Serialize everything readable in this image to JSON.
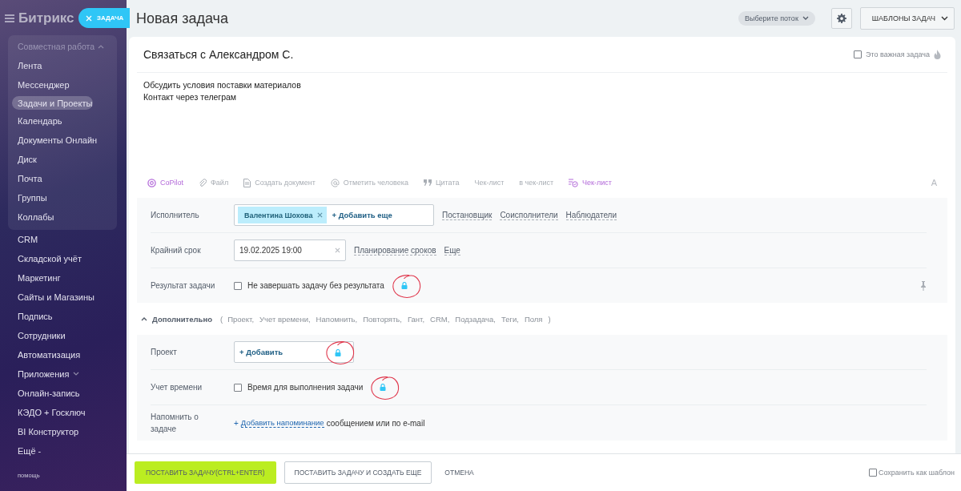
{
  "sidebar": {
    "logo": "Битрикс",
    "pill": "ЗАДАЧА",
    "group": {
      "label": "Совместная работа",
      "expanded": true,
      "children": [
        {
          "label": "Лента",
          "selected": false
        },
        {
          "label": "Мессенджер",
          "selected": false
        },
        {
          "label": "Задачи и Проекты",
          "selected": true
        },
        {
          "label": "Календарь",
          "selected": false
        },
        {
          "label": "Документы Онлайн",
          "selected": false
        },
        {
          "label": "Диск",
          "selected": false
        },
        {
          "label": "Почта",
          "selected": false
        },
        {
          "label": "Группы",
          "selected": false
        },
        {
          "label": "Коллабы",
          "selected": false
        }
      ]
    },
    "items": [
      {
        "label": "CRM",
        "selected": false
      },
      {
        "label": "Складской учёт",
        "selected": false
      },
      {
        "label": "Маркетинг",
        "selected": false
      },
      {
        "label": "Сайты и Магазины",
        "selected": false
      },
      {
        "label": "Подпись",
        "selected": false
      },
      {
        "label": "Сотрудники",
        "selected": false
      },
      {
        "label": "Автоматизация",
        "selected": false
      },
      {
        "label": "Приложения",
        "selected": false,
        "expanded": false
      },
      {
        "label": "Онлайн-запись",
        "selected": false
      },
      {
        "label": "КЭДО + Госключ",
        "selected": false
      },
      {
        "label": "BI Конструктор",
        "selected": false
      },
      {
        "label": "Ещё -",
        "selected": false
      }
    ],
    "footer": "помощь"
  },
  "header": {
    "title": "Новая задача",
    "flow": "Выберите поток",
    "templates": "ШАБЛОНЫ ЗАДАЧ"
  },
  "task": {
    "title": "Связаться с Александром С.",
    "important": {
      "label": "Это важная задача",
      "checked": false
    },
    "description": [
      "Обсудить условия поставки материалов",
      "Контакт через телеграм"
    ]
  },
  "toolbar": [
    {
      "kind": "copilot",
      "label": "CoPilot"
    },
    {
      "kind": "file",
      "label": "Файл"
    },
    {
      "kind": "doc",
      "label": "Создать документ"
    },
    {
      "kind": "mention",
      "label": "Отметить человека"
    },
    {
      "kind": "quote",
      "label": "Цитата"
    },
    {
      "kind": "plain",
      "label": "Чек-лист"
    },
    {
      "kind": "plain",
      "label": "в чек-лист"
    },
    {
      "kind": "checklist",
      "label": "Чек-лист"
    }
  ],
  "format_button": "A",
  "main_fields": {
    "assignee": {
      "label": "Исполнитель",
      "tag": "Валентина Шохова",
      "add": "+ Добавить еще",
      "links": [
        "Постановщик",
        "Соисполнители",
        "Наблюдатели"
      ]
    },
    "deadline": {
      "label": "Крайний срок",
      "value": "19.02.2025 19:00",
      "links": [
        "Планирование сроков",
        "Еще"
      ]
    },
    "result": {
      "label": "Результат задачи",
      "option": "Не завершать задачу без результата",
      "checked": false,
      "locked": true
    }
  },
  "extra": {
    "title": "Дополнительно",
    "expanded": true,
    "open": "(",
    "close": ")",
    "items": [
      "Проект,",
      "Учет времени,",
      "Напомнить,",
      "Повторять,",
      "Гант,",
      "CRM,",
      "Подзадача,",
      "Теги,",
      "Поля"
    ]
  },
  "extra_fields": {
    "project": {
      "label": "Проект",
      "add": "+ Добавить",
      "locked": true
    },
    "time": {
      "label": "Учет времени",
      "option": "Время для выполнения задачи",
      "checked": false,
      "locked": true
    },
    "remind": {
      "label": "Напомнить о задаче",
      "plus": "+",
      "link": "Добавить напоминание",
      "rest": "сообщением или по e-mail"
    }
  },
  "footer": {
    "submit": "ПОСТАВИТЬ ЗАДАЧУ(CTRL+ENTER)",
    "submit_more": "ПОСТАВИТЬ ЗАДАЧУ И СОЗДАТЬ ЕЩЕ",
    "cancel": "ОТМЕНА",
    "template": {
      "label": "Сохранить как шаблон",
      "checked": false
    }
  }
}
